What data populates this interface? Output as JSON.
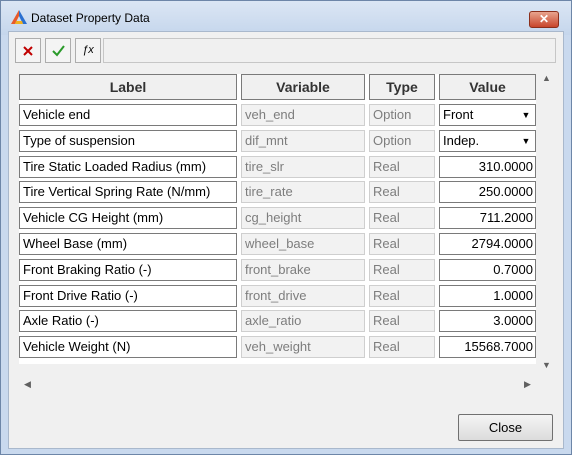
{
  "window": {
    "title": "Dataset Property Data",
    "close_glyph": "✕"
  },
  "toolbar": {
    "cancel_icon": "x-icon",
    "cancel_color": "#c00000",
    "ok_icon": "check-icon",
    "ok_color": "#2a9a2a",
    "fx_label": "ƒx"
  },
  "table": {
    "headers": [
      "Label",
      "Variable",
      "Type",
      "Value"
    ],
    "rows": [
      {
        "label": "Vehicle end",
        "variable": "veh_end",
        "type": "Option",
        "value": "Front",
        "dropdown": true
      },
      {
        "label": "Type of suspension",
        "variable": "dif_mnt",
        "type": "Option",
        "value": "Indep.",
        "dropdown": true
      },
      {
        "label": "Tire Static Loaded Radius (mm)",
        "variable": "tire_slr",
        "type": "Real",
        "value": "310.0000",
        "dropdown": false
      },
      {
        "label": "Tire Vertical Spring Rate (N/mm)",
        "variable": "tire_rate",
        "type": "Real",
        "value": "250.0000",
        "dropdown": false
      },
      {
        "label": "Vehicle CG Height (mm)",
        "variable": "cg_height",
        "type": "Real",
        "value": "711.2000",
        "dropdown": false
      },
      {
        "label": "Wheel Base (mm)",
        "variable": "wheel_base",
        "type": "Real",
        "value": "2794.0000",
        "dropdown": false
      },
      {
        "label": "Front Braking Ratio (-)",
        "variable": "front_brake",
        "type": "Real",
        "value": "0.7000",
        "dropdown": false
      },
      {
        "label": "Front Drive Ratio (-)",
        "variable": "front_drive",
        "type": "Real",
        "value": "1.0000",
        "dropdown": false
      },
      {
        "label": "Axle Ratio (-)",
        "variable": "axle_ratio",
        "type": "Real",
        "value": "3.0000",
        "dropdown": false
      },
      {
        "label": "Vehicle Weight (N)",
        "variable": "veh_weight",
        "type": "Real",
        "value": "15568.7000",
        "dropdown": false
      }
    ]
  },
  "footer": {
    "close_label": "Close"
  }
}
